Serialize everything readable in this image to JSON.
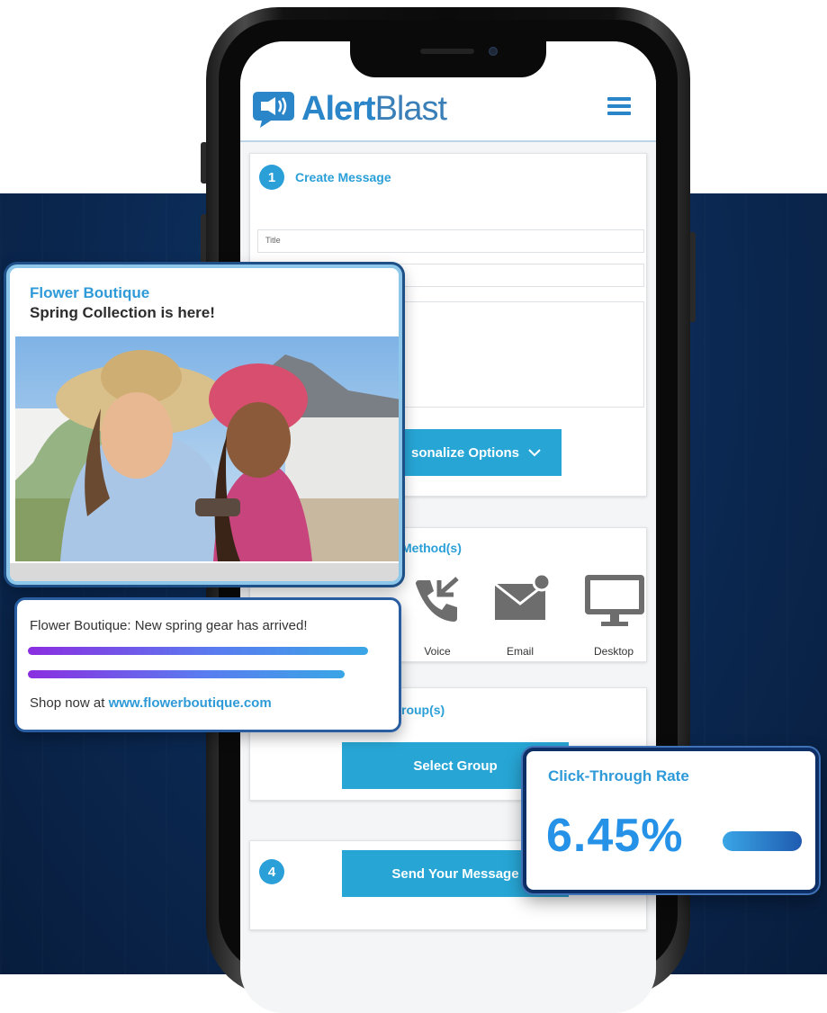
{
  "app": {
    "logo_bold": "Alert",
    "logo_thin": "Blast"
  },
  "steps": {
    "step1": {
      "number": "1",
      "title": "Create Message",
      "title_placeholder": "Title",
      "personalize_label": "sonalize Options"
    },
    "step2": {
      "title": "Method(s)",
      "methods": [
        "Voice",
        "Email",
        "Desktop"
      ]
    },
    "step3": {
      "title": "roup(s)",
      "select_label": "Select Group"
    },
    "step4": {
      "number": "4",
      "send_label": "Send Your Message"
    }
  },
  "notification_card": {
    "brand": "Flower Boutique",
    "headline": "Spring Collection is here!"
  },
  "sms_card": {
    "message": "Flower Boutique: New spring gear has arrived!",
    "footer_prefix": "Shop now at ",
    "footer_link": "www.flowerboutique.com"
  },
  "ctr_card": {
    "label": "Click-Through Rate",
    "value": "6.45%"
  },
  "colors": {
    "brand_blue": "#2a9fd8",
    "button_blue": "#27a6d6",
    "navy": "#0b2a55"
  }
}
